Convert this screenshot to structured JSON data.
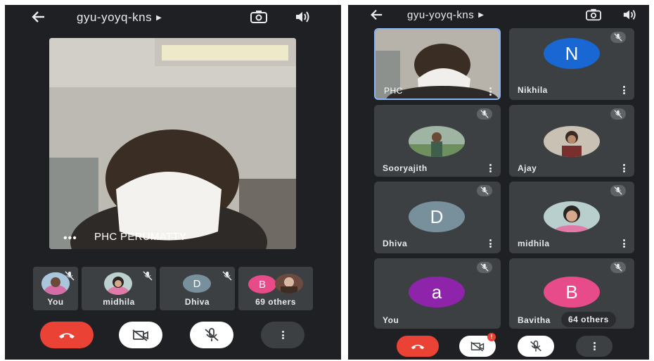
{
  "meeting": {
    "code": "gyu-yoyq-kns"
  },
  "left": {
    "main_tile_name": "PHC PERUMATTY",
    "strip": [
      {
        "name": "You"
      },
      {
        "name": "midhila"
      },
      {
        "name": "Dhiva",
        "initial": "D"
      },
      {
        "name": "69 others",
        "initial": "B"
      }
    ]
  },
  "right": {
    "tiles": [
      {
        "name": "PHC"
      },
      {
        "name": "Nikhila",
        "initial": "N"
      },
      {
        "name": "Sooryajith"
      },
      {
        "name": "Ajay"
      },
      {
        "name": "Dhiva",
        "initial": "D"
      },
      {
        "name": "midhila"
      },
      {
        "name": "You",
        "initial": "a"
      },
      {
        "name": "Bavitha",
        "initial": "B"
      }
    ],
    "others_label": "64 others",
    "video_badge": "!"
  },
  "colors": {
    "panel": "#1f2023",
    "tile": "#3c4043",
    "end_call": "#ea4335",
    "accent_blue": "#1a73e8",
    "avatar_n": "#1967d2",
    "avatar_d": "#78909c",
    "avatar_a": "#8e24aa",
    "avatar_b": "#e84b8a"
  },
  "icons": [
    "back-arrow-icon",
    "switch-camera-icon",
    "speaker-icon",
    "mic-off-icon",
    "more-icon",
    "end-call-icon",
    "camera-off-icon"
  ]
}
